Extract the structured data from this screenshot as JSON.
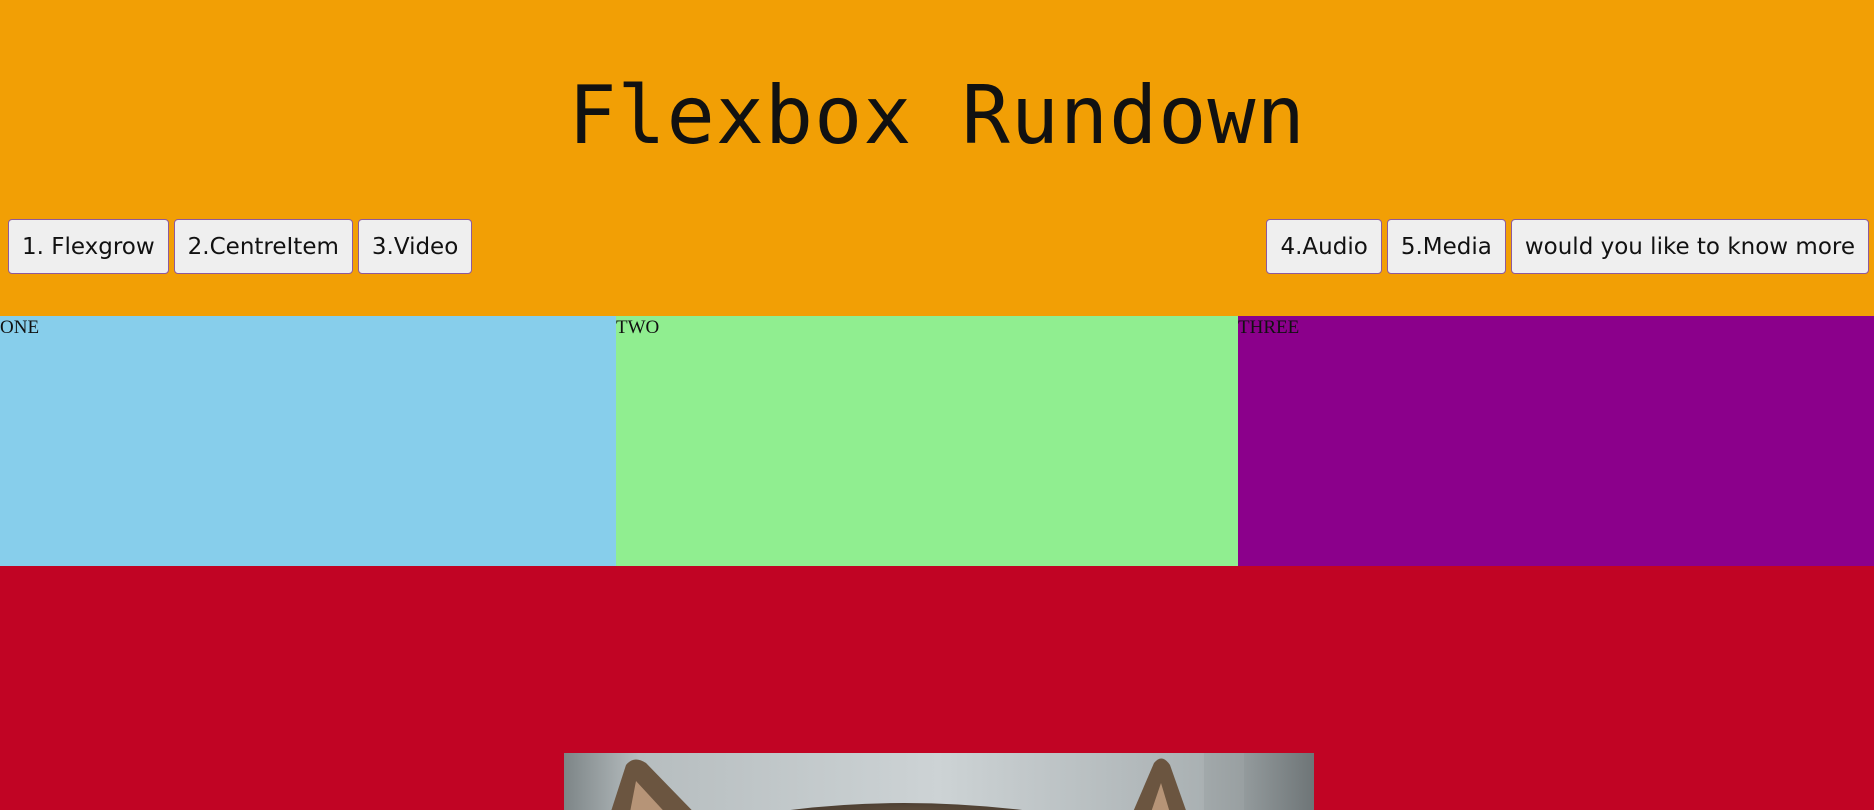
{
  "header": {
    "title": "Flexbox Rundown",
    "background": "#f29f05"
  },
  "nav": {
    "left": [
      {
        "label": "1. Flexgrow"
      },
      {
        "label": "2.CentreItem"
      },
      {
        "label": "3.Video"
      }
    ],
    "right": [
      {
        "label": "4.Audio"
      },
      {
        "label": "5.Media"
      },
      {
        "label": "would you like to know more"
      }
    ]
  },
  "boxes": [
    {
      "label": "ONE",
      "color": "#87ceeb"
    },
    {
      "label": "TWO",
      "color": "#90ee90"
    },
    {
      "label": "THREE",
      "color": "#8b008b"
    }
  ],
  "media_section": {
    "background": "#c10424",
    "image_subject": "cat-photo"
  }
}
